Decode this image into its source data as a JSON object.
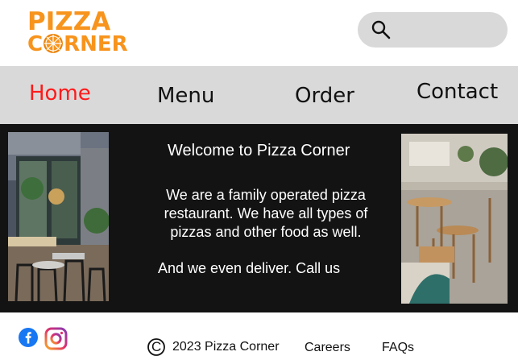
{
  "brand": {
    "logo_top": "PIZZA",
    "logo_bottom_left": "C",
    "logo_bottom_right": "RNER",
    "color": "#f7941d"
  },
  "search": {
    "icon": "search-icon"
  },
  "nav": {
    "items": [
      {
        "label": "Home",
        "active": true
      },
      {
        "label": "Menu",
        "active": false
      },
      {
        "label": "Order",
        "active": false
      },
      {
        "label": "Contact",
        "active": false
      }
    ],
    "active_color": "#ff1a1a"
  },
  "hero": {
    "title": "Welcome to Pizza Corner",
    "para_lines": [
      "We are a family operated pizza",
      "restaurant.  We have all types of",
      "pizzas and other food as well."
    ],
    "deliver_text": "And we even deliver. Call us"
  },
  "footer": {
    "social": [
      "facebook-icon",
      "instagram-icon"
    ],
    "copyright_symbol": "C",
    "copyright_text": "2023 Pizza Corner",
    "links": [
      "Careers",
      "FAQs"
    ]
  }
}
